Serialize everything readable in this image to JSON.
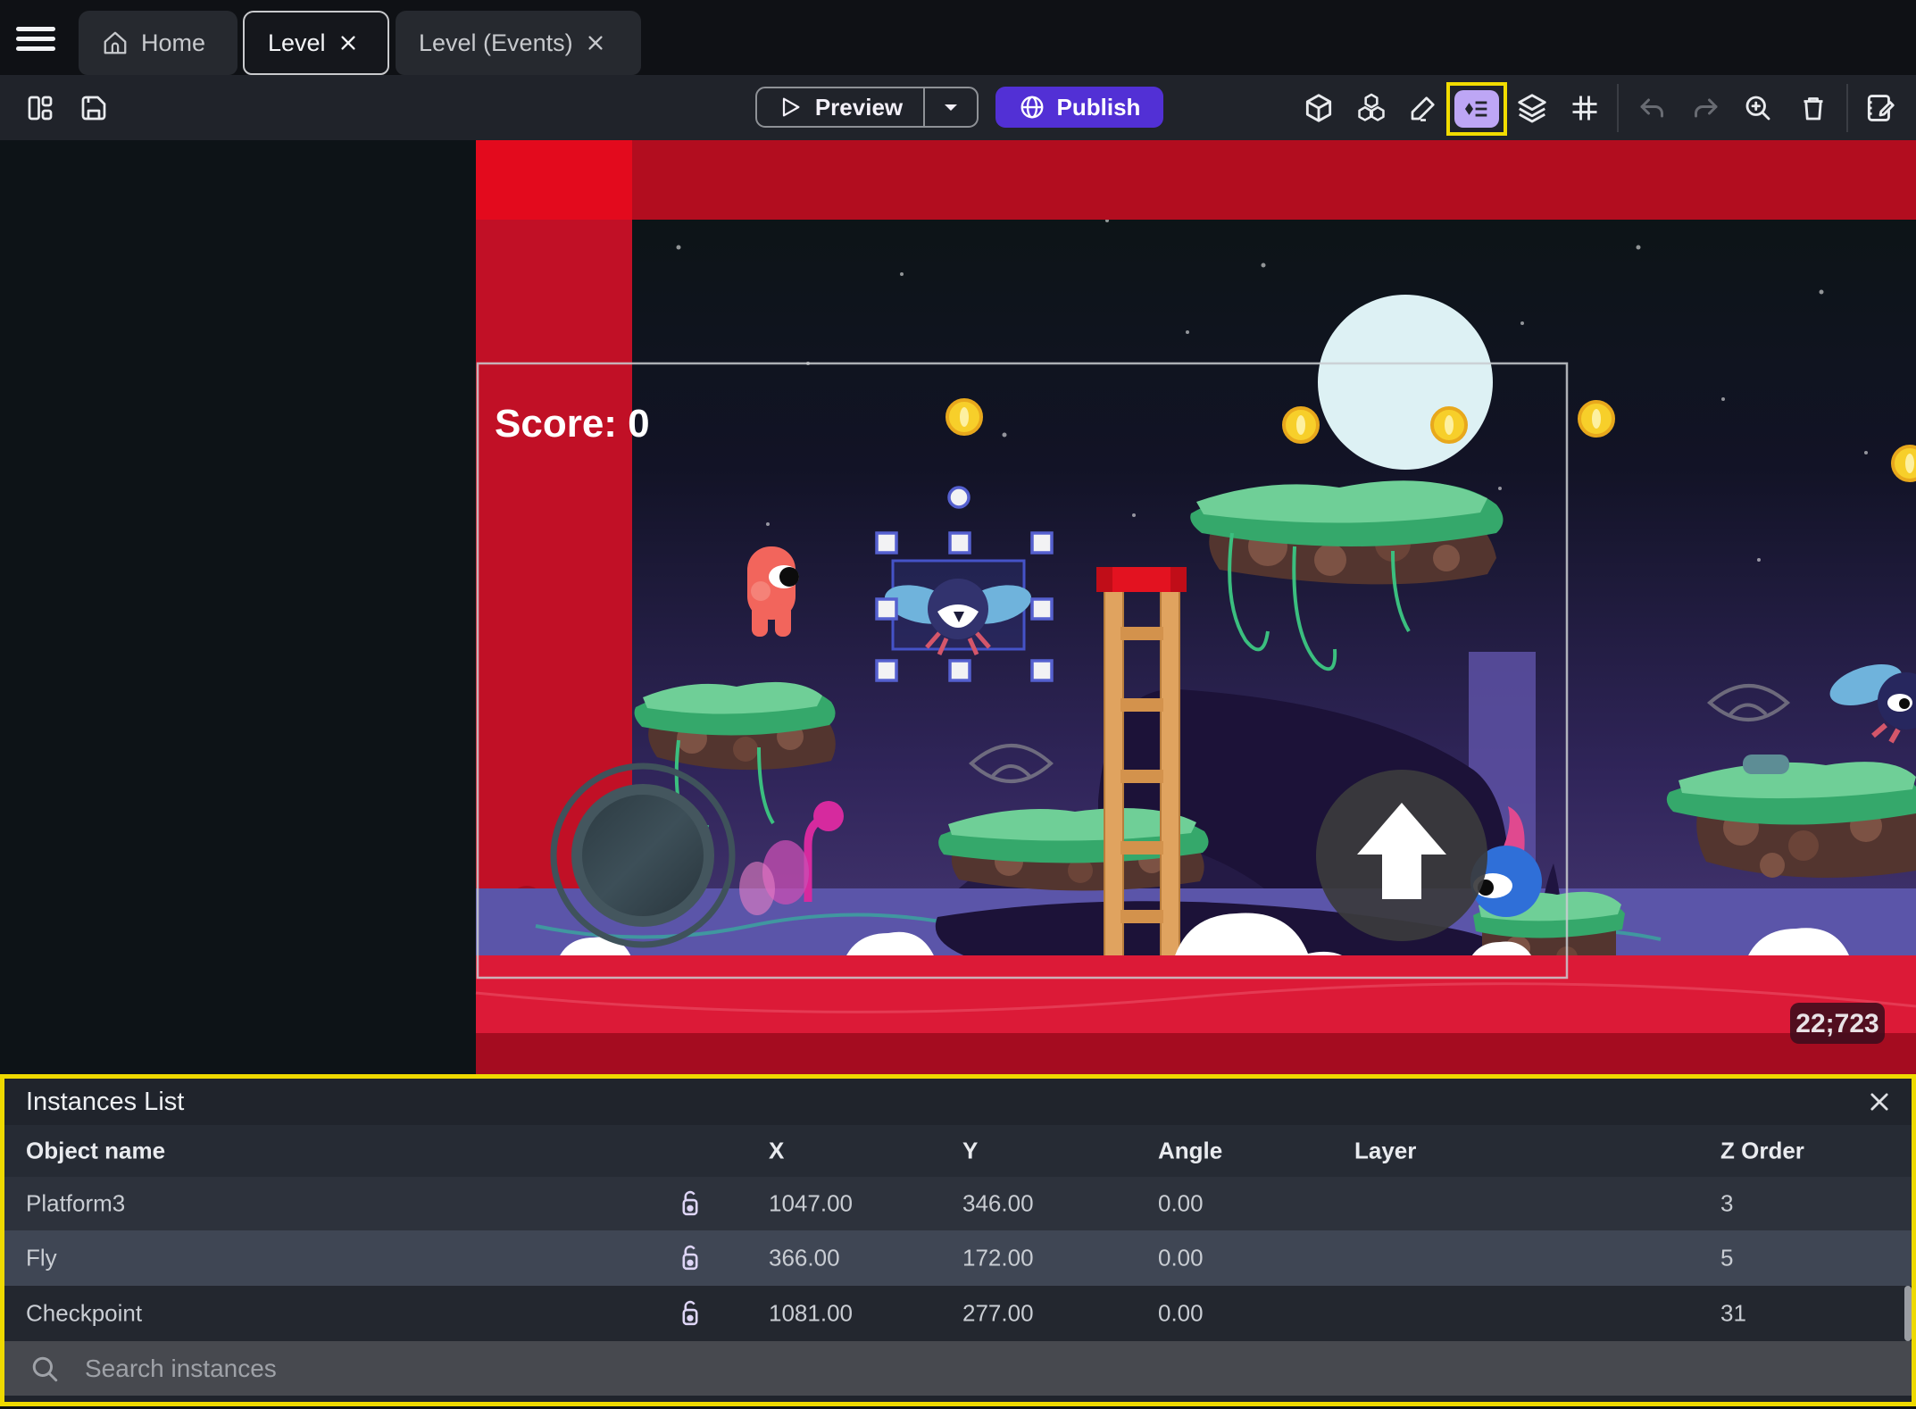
{
  "tabbar": {
    "home": "Home",
    "level": "Level",
    "level_events": "Level (Events)"
  },
  "toolbar": {
    "preview_label": "Preview",
    "publish_label": "Publish",
    "icons": [
      "panels-icon",
      "save-icon",
      "objects-cube-icon",
      "object-groups-icon",
      "properties-pencil-icon",
      "instances-list-icon",
      "layers-icon",
      "grid-icon",
      "undo-icon",
      "redo-icon",
      "zoom-in-icon",
      "trash-icon",
      "edit-scene-icon"
    ]
  },
  "scene": {
    "score_text": "Score: 0",
    "coords_badge": "22;723"
  },
  "panel": {
    "title": "Instances List",
    "columns": [
      "Object name",
      "X",
      "Y",
      "Angle",
      "Layer",
      "Z Order"
    ],
    "rows": [
      {
        "name": "Platform3",
        "x": "1047.00",
        "y": "346.00",
        "angle": "0.00",
        "layer": "",
        "z": "3"
      },
      {
        "name": "Fly",
        "x": "366.00",
        "y": "172.00",
        "angle": "0.00",
        "layer": "",
        "z": "5"
      },
      {
        "name": "Checkpoint",
        "x": "1081.00",
        "y": "277.00",
        "angle": "0.00",
        "layer": "",
        "z": "31"
      }
    ],
    "search_placeholder": "Search instances"
  },
  "colors": {
    "accent_purple": "#5230d5",
    "highlight_yellow": "#f2dc00",
    "instances_pill": "#bda6f5",
    "selection_blue": "#5560cf",
    "red_stripe": "#c11026",
    "red_band": "#b20d1f",
    "banner_red": "#dc1a37",
    "row_selected": "#3f4654"
  }
}
